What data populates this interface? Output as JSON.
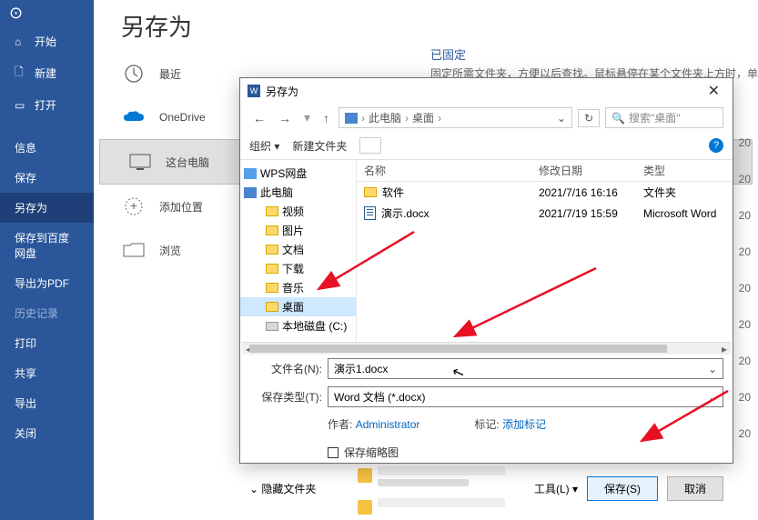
{
  "sidebar": {
    "back_glyph": "⊙",
    "items": [
      {
        "icon": "⌂",
        "label": "开始"
      },
      {
        "icon": "🗋",
        "label": "新建"
      },
      {
        "icon": "▭",
        "label": "打开"
      }
    ],
    "items2": [
      {
        "label": "信息"
      },
      {
        "label": "保存"
      },
      {
        "label": "另存为",
        "selected": true
      },
      {
        "label": "保存到百度网盘"
      },
      {
        "label": "导出为PDF"
      },
      {
        "label": "历史记录",
        "disabled": true
      },
      {
        "label": "打印"
      },
      {
        "label": "共享"
      },
      {
        "label": "导出"
      },
      {
        "label": "关闭"
      }
    ]
  },
  "backstage": {
    "title": "另存为",
    "locations": [
      {
        "label": "最近"
      },
      {
        "label": "OneDrive"
      },
      {
        "label": "这台电脑",
        "selected": true
      },
      {
        "label": "添加位置"
      },
      {
        "label": "浏览"
      }
    ],
    "pinned": {
      "header": "已固定",
      "desc": "固定所需文件夹，方便以后查找。鼠标悬停在某个文件夹上方时，单击显示的图钉图标。"
    },
    "date_partial": "20"
  },
  "dialog": {
    "title": "另存为",
    "close": "✕",
    "nav": {
      "back": "←",
      "fwd": "→",
      "up": "↑",
      "this_pc": "此电脑",
      "desktop": "桌面",
      "dd": "⌄",
      "refresh": "↻",
      "search_placeholder": "搜索\"桌面\"",
      "search_icon": "🔍"
    },
    "toolbar": {
      "organize": "组织 ▾",
      "new_folder": "新建文件夹",
      "help": "?"
    },
    "tree": [
      {
        "label": "WPS网盘",
        "kind": "root"
      },
      {
        "label": "此电脑",
        "kind": "root-pc"
      },
      {
        "label": "视频",
        "kind": "f"
      },
      {
        "label": "图片",
        "kind": "f"
      },
      {
        "label": "文档",
        "kind": "f"
      },
      {
        "label": "下载",
        "kind": "f"
      },
      {
        "label": "音乐",
        "kind": "f"
      },
      {
        "label": "桌面",
        "kind": "f",
        "selected": true
      },
      {
        "label": "本地磁盘 (C:)",
        "kind": "d"
      }
    ],
    "columns": {
      "name": "名称",
      "date": "修改日期",
      "type": "类型"
    },
    "rows": [
      {
        "name": "软件",
        "icon": "folder",
        "date": "2021/7/16 16:16",
        "type": "文件夹"
      },
      {
        "name": "演示.docx",
        "icon": "doc",
        "date": "2021/7/19 15:59",
        "type": "Microsoft Word"
      }
    ],
    "filename": {
      "label": "文件名(N):",
      "value": "演示1.docx"
    },
    "filetype": {
      "label": "保存类型(T):",
      "value": "Word 文档 (*.docx)"
    },
    "author": {
      "label": "作者:",
      "value": "Administrator"
    },
    "tags": {
      "label": "标记:",
      "value": "添加标记"
    },
    "thumb": "保存缩略图",
    "footer": {
      "hide": "隐藏文件夹",
      "caret": "⌄",
      "tools": "工具(L) ▾",
      "save": "保存(S)",
      "cancel": "取消"
    }
  }
}
